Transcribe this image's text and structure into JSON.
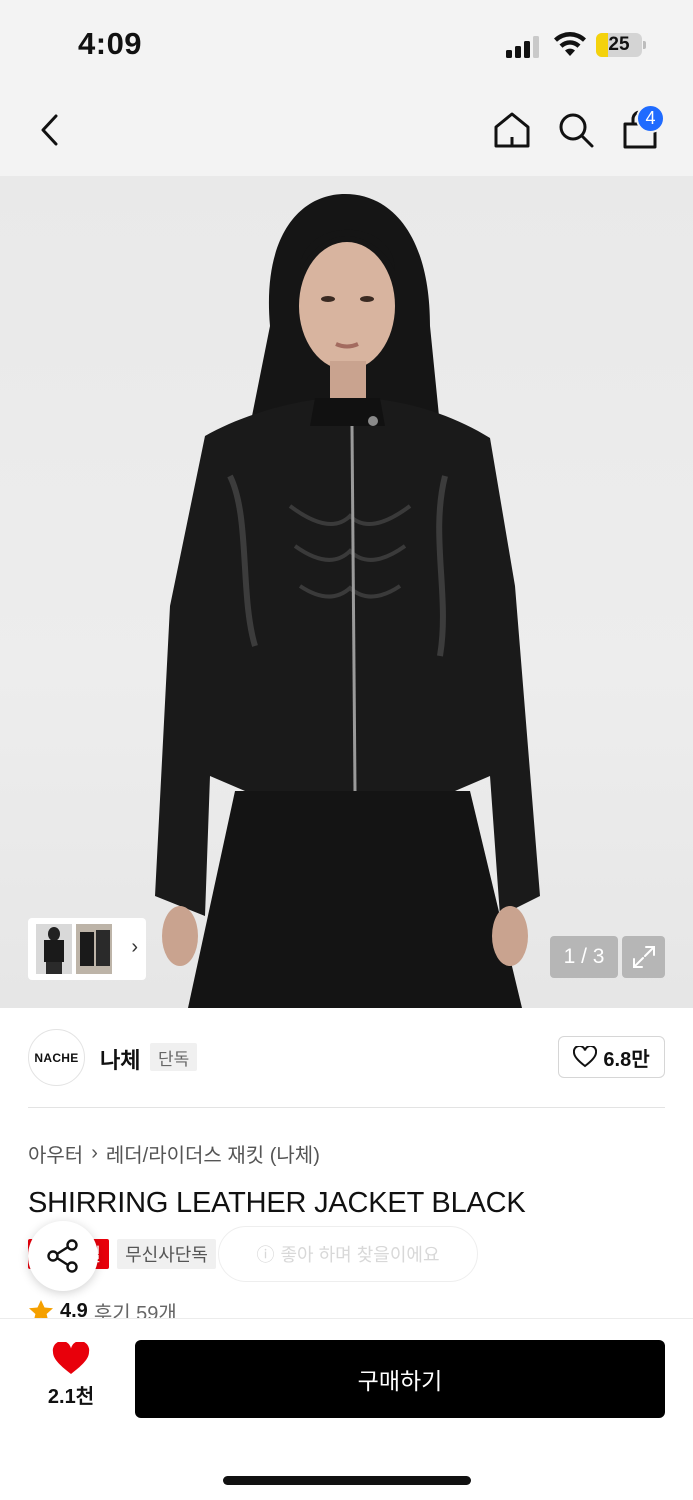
{
  "status_bar": {
    "time": "4:09",
    "battery_level": "25",
    "battery_fill_percent": 25
  },
  "nav": {
    "cart_count": "4"
  },
  "gallery": {
    "page_counter": "1 / 3"
  },
  "brand": {
    "logo_text": "NACHE",
    "name": "나체",
    "tag": "단독",
    "likes": "6.8만"
  },
  "product": {
    "breadcrumb": [
      "아우터",
      "레더/라이더스 재킷 (나체)"
    ],
    "title": "SHIRRING LEATHER JACKET BLACK",
    "tag_sale": "세일",
    "tag_exclusive": "무신사단독",
    "ghost_pill_text": "좋아 하며 찾을이에요"
  },
  "rating": {
    "score": "4.9",
    "reviews": "후기 59개"
  },
  "bottom": {
    "wishlist_count": "2.1천",
    "buy_label": "구매하기"
  },
  "colors": {
    "cart_badge": "#1f6bff",
    "sale_red": "#e8000b",
    "heart_red": "#e8000b",
    "star": "#f5a000",
    "buy_button": "#000000"
  }
}
